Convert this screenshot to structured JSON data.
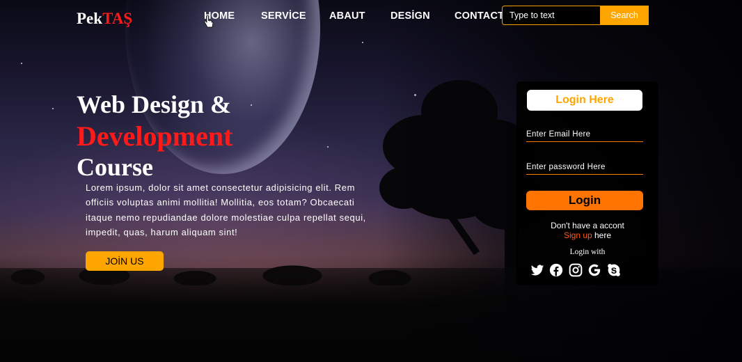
{
  "brand": {
    "part1": "Pek",
    "part2": "TAŞ"
  },
  "nav": {
    "items": [
      {
        "label": "HOME"
      },
      {
        "label": "SERVİCE"
      },
      {
        "label": "ABAUT"
      },
      {
        "label": "DESİGN"
      },
      {
        "label": "CONTACT"
      }
    ],
    "search_placeholder": "Type to text",
    "search_label": "Search"
  },
  "hero": {
    "line1": "Web Design &",
    "line2": "Development",
    "line3": "Course",
    "paragraph": "Lorem ipsum, dolor sit amet consectetur adipisicing elit. Rem officiis voluptas animi mollitia! Mollitia, eos totam? Obcaecati itaque nemo repudiandae dolore molestiae culpa repellat sequi, impedit, quas, harum aliquam sint!",
    "join_label": "JOİN US"
  },
  "login": {
    "title": "Login Here",
    "email_placeholder": "Enter Email Here",
    "password_placeholder": "Enter password Here",
    "button_label": "Login",
    "no_account_text": "Don't have a accont",
    "signup_link": "Sign up",
    "signup_suffix": " here",
    "login_with": "Login with",
    "socials": [
      "twitter-icon",
      "facebook-icon",
      "instagram-icon",
      "google-icon",
      "skype-icon"
    ]
  },
  "colors": {
    "accent": "#ffa500",
    "login_button": "#ff7300",
    "brand_red": "#ff1a1a",
    "signup_link": "#ff5a1a"
  }
}
